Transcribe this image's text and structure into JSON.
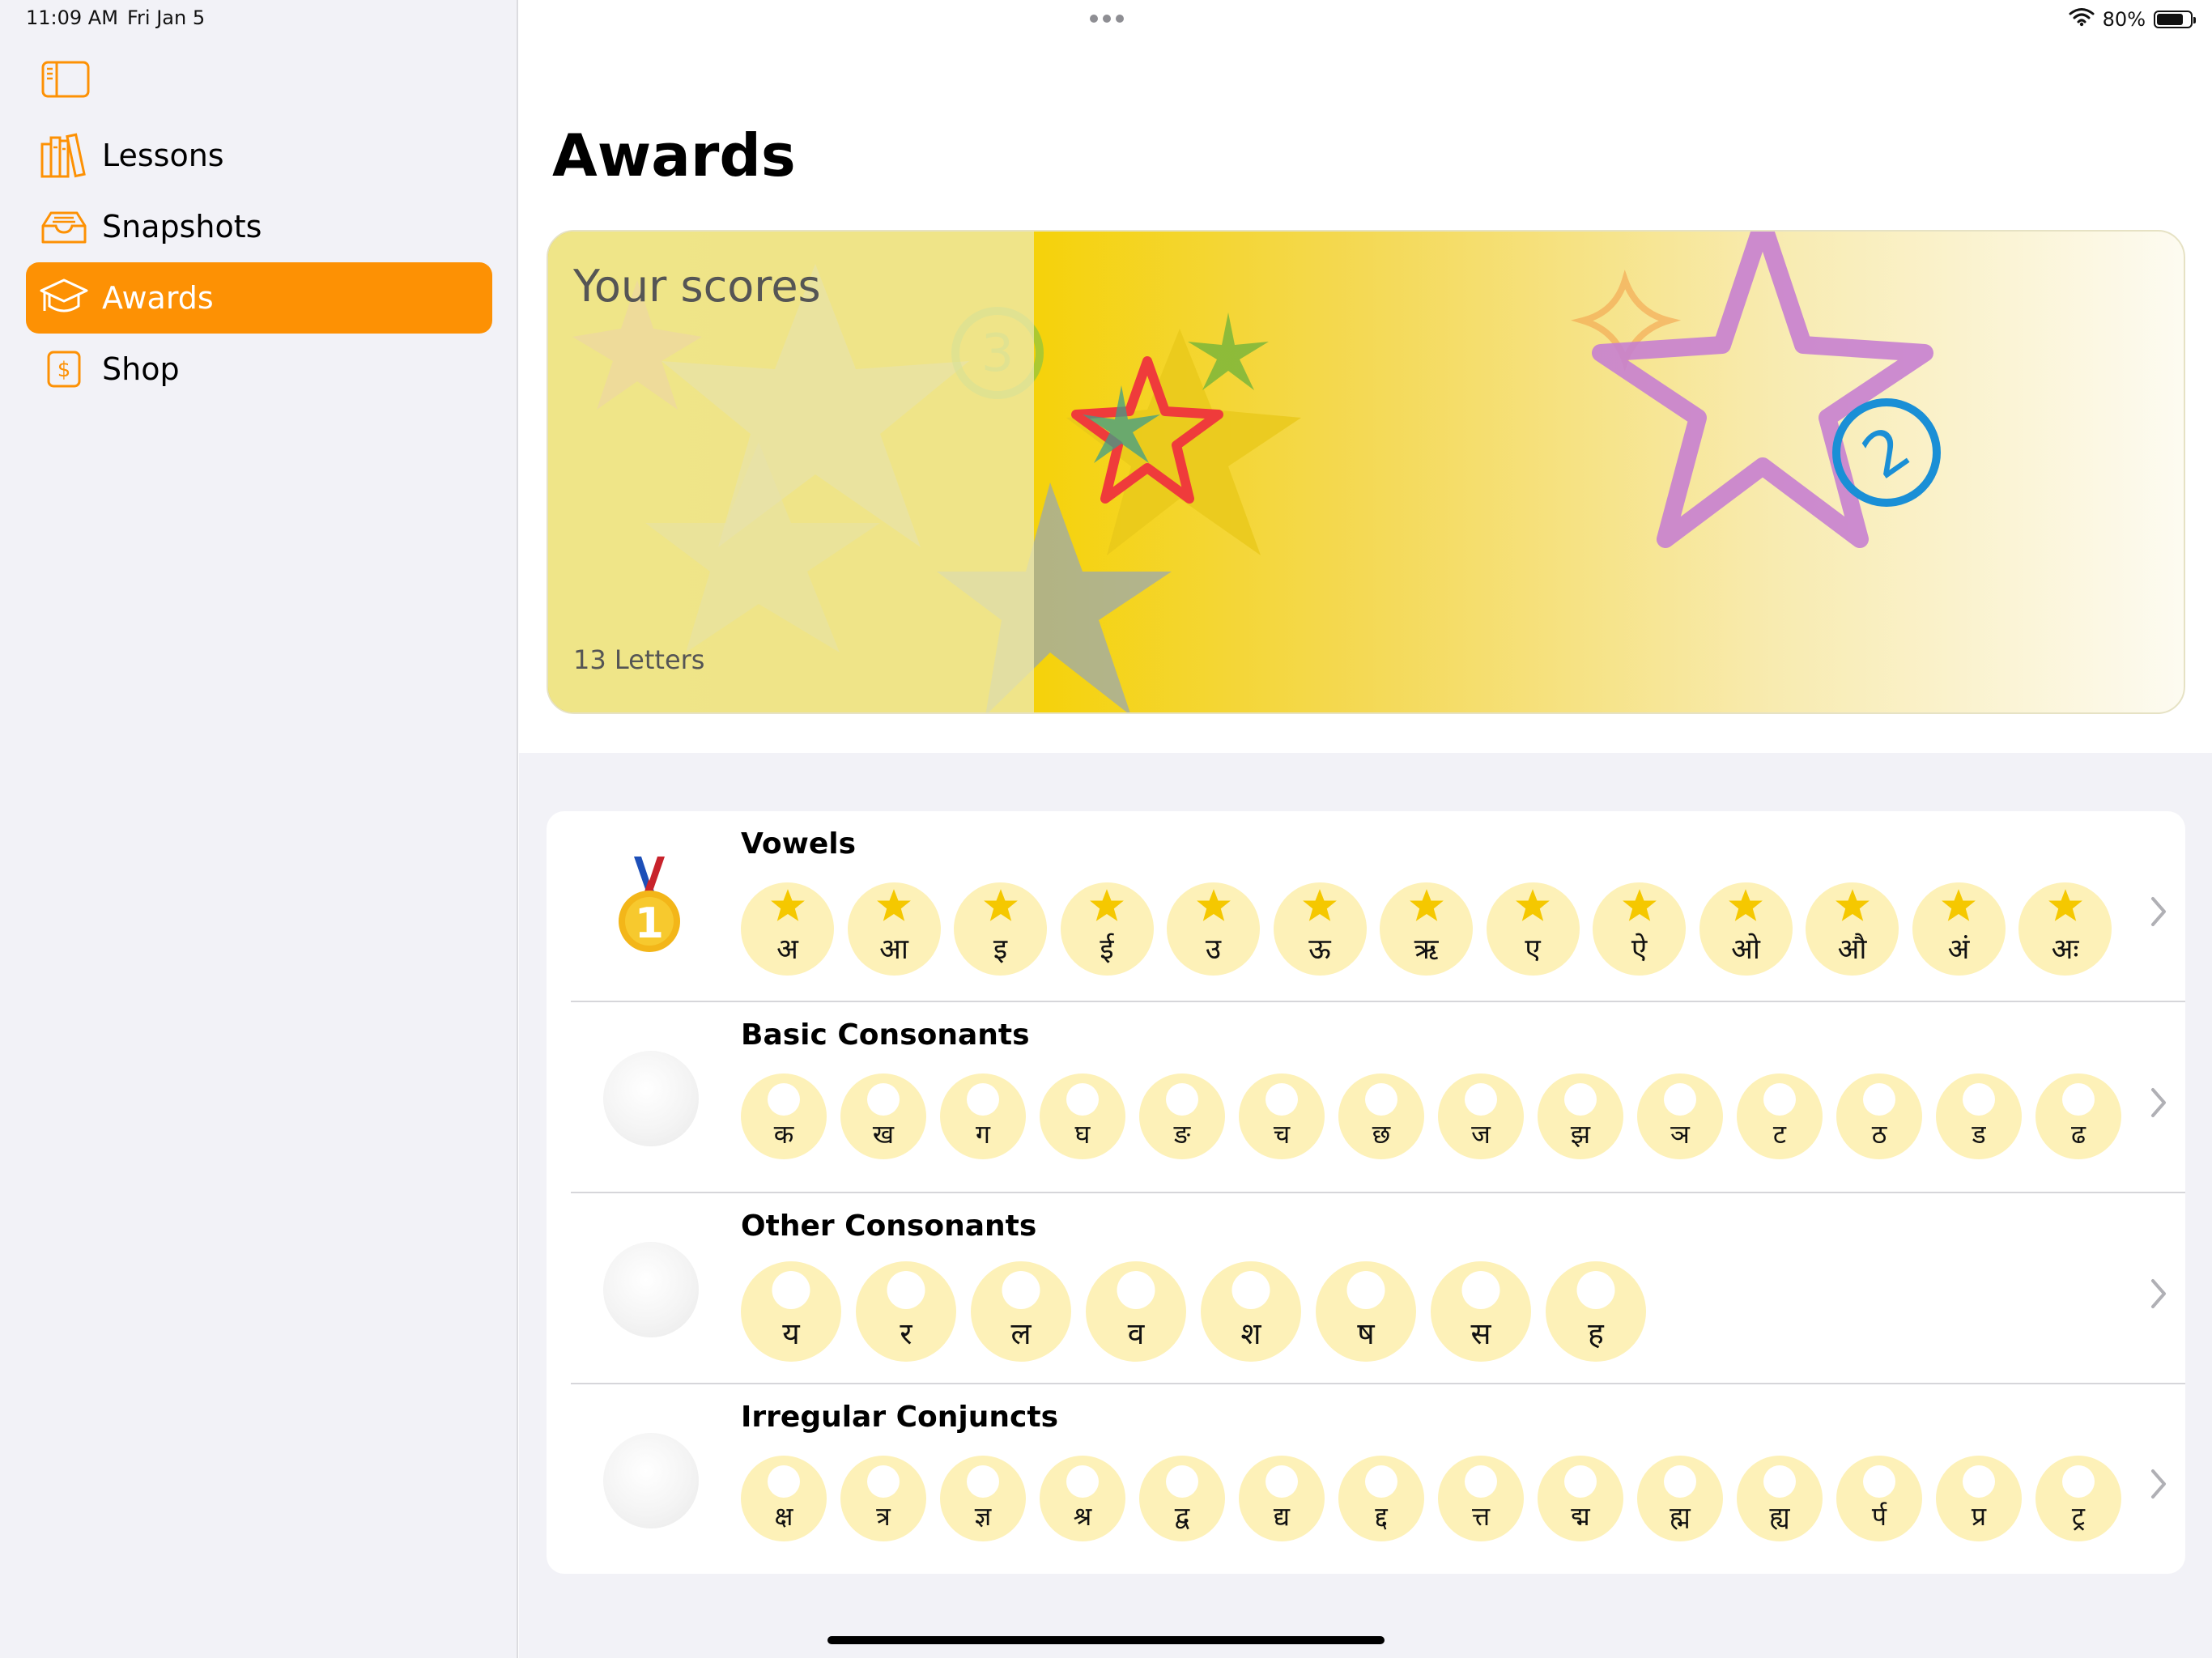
{
  "status_bar": {
    "time": "11:09 AM",
    "date": "Fri Jan 5",
    "battery": "80%",
    "battery_level": 0.8
  },
  "sidebar": {
    "toggle_icon": "sidebar-toggle-icon",
    "items": [
      {
        "label": "Lessons",
        "icon": "books-icon"
      },
      {
        "label": "Snapshots",
        "icon": "tray-icon"
      },
      {
        "label": "Awards",
        "icon": "graduation-cap-icon"
      },
      {
        "label": "Shop",
        "icon": "dollar-sign-icon"
      }
    ],
    "selected": "Awards"
  },
  "main": {
    "title": "Awards",
    "score_card": {
      "title": "Your scores",
      "subtitle": "13 Letters",
      "badge_number": "2"
    },
    "rows": [
      {
        "title": "Vowels",
        "medal": "gold-medal-1",
        "completed": true,
        "letters": [
          "अ",
          "आ",
          "इ",
          "ई",
          "उ",
          "ऊ",
          "ऋ",
          "ए",
          "ऐ",
          "ओ",
          "औ",
          "अं",
          "अः"
        ]
      },
      {
        "title": "Basic Consonants",
        "medal": "none",
        "completed": false,
        "letters": [
          "क",
          "ख",
          "ग",
          "घ",
          "ङ",
          "च",
          "छ",
          "ज",
          "झ",
          "ञ",
          "ट",
          "ठ",
          "ड",
          "ढ"
        ]
      },
      {
        "title": "Other Consonants",
        "medal": "none",
        "completed": false,
        "letters": [
          "य",
          "र",
          "ल",
          "व",
          "श",
          "ष",
          "स",
          "ह"
        ]
      },
      {
        "title": "Irregular Conjuncts",
        "medal": "none",
        "completed": false,
        "letters": [
          "क्ष",
          "त्र",
          "ज्ञ",
          "श्र",
          "द्व",
          "द्य",
          "द्द",
          "त्त",
          "द्म",
          "ह्म",
          "ह्य",
          "र्प",
          "प्र",
          "ट्र"
        ]
      }
    ]
  },
  "colors": {
    "accent": "#fd9104",
    "star": "#f5c800",
    "letter_bg": "#fdf1b8",
    "badge": "#1a8fd6"
  }
}
